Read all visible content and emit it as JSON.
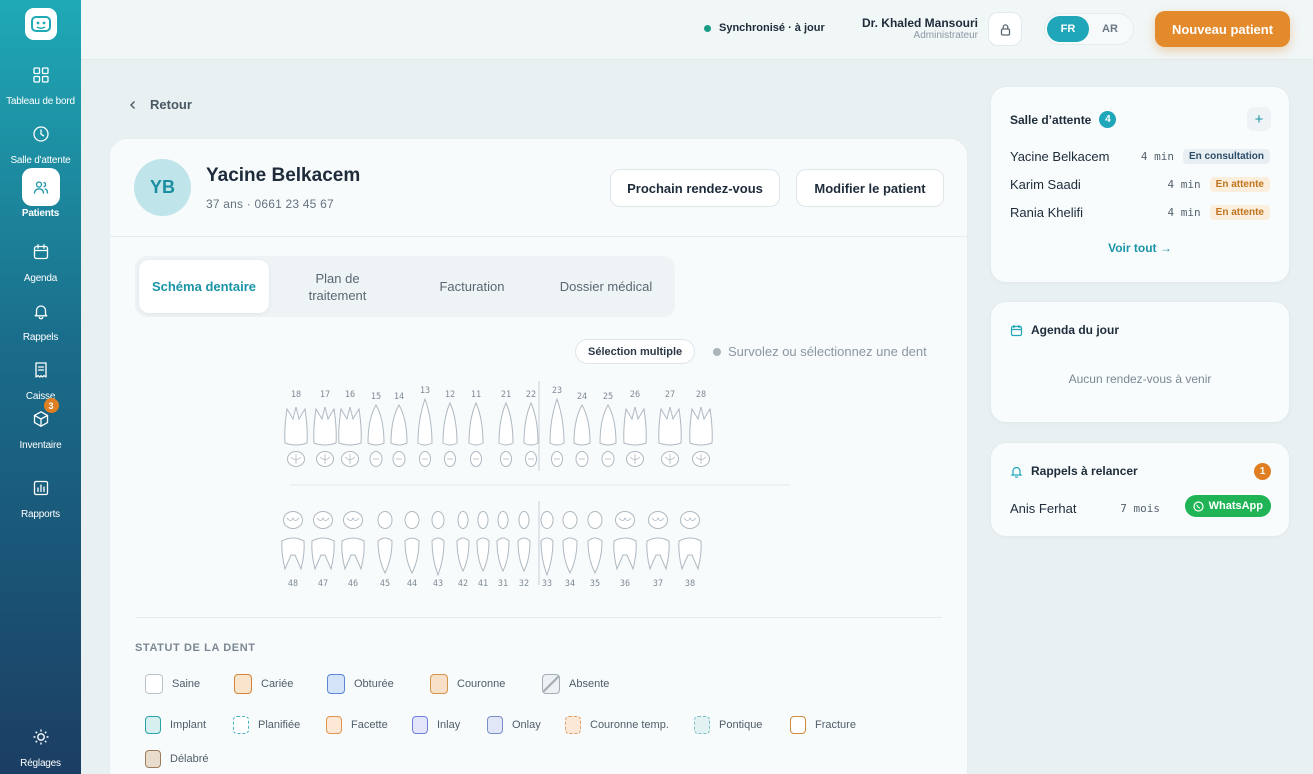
{
  "sidebar": {
    "items": [
      {
        "label": "Tableau de bord",
        "icon": "dashboard-grid-icon"
      },
      {
        "label": "Salle d'attente",
        "icon": "clock-icon"
      },
      {
        "label": "Patients",
        "icon": "users-icon",
        "active": true
      },
      {
        "label": "Agenda",
        "icon": "calendar-icon"
      },
      {
        "label": "Rappels",
        "icon": "bell-icon"
      },
      {
        "label": "Caisse",
        "icon": "receipt-icon"
      },
      {
        "label": "Inventaire",
        "icon": "box-icon",
        "badge": "3"
      },
      {
        "label": "Rapports",
        "icon": "bar-chart-icon"
      }
    ],
    "settings_label": "Réglages"
  },
  "topbar": {
    "sync_status": "Synchronisé · à jour",
    "user_name": "Dr. Khaled Mansouri",
    "user_role": "Administrateur",
    "lang_fr": "FR",
    "lang_ar": "AR",
    "new_patient_label": "Nouveau patient"
  },
  "back_label": "Retour",
  "patient": {
    "initials": "YB",
    "name": "Yacine Belkacem",
    "meta": "37 ans · 0661 23 45 67",
    "next_appointment_label": "Prochain rendez-vous",
    "edit_label": "Modifier le patient"
  },
  "tabs": [
    {
      "label": "Schéma dentaire",
      "active": true
    },
    {
      "label": "Plan de traitement"
    },
    {
      "label": "Facturation"
    },
    {
      "label": "Dossier médical"
    }
  ],
  "dental_chart": {
    "multi_select_label": "Sélection multiple",
    "hint": "Survolez ou sélectionnez une dent",
    "upper_numbers": [
      "18",
      "17",
      "16",
      "15",
      "14",
      "13",
      "12",
      "11",
      "21",
      "22",
      "23",
      "24",
      "25",
      "26",
      "27",
      "28"
    ],
    "lower_numbers": [
      "48",
      "47",
      "46",
      "45",
      "44",
      "43",
      "42",
      "41",
      "31",
      "32",
      "33",
      "34",
      "35",
      "36",
      "37",
      "38"
    ]
  },
  "tooth_status": {
    "title": "STATUT DE LA DENT",
    "primary": [
      {
        "label": "Saine",
        "color": "#b7c2ca",
        "fill": "#ffffff"
      },
      {
        "label": "Cariée",
        "color": "#d4843a",
        "fill": "#fbe4cc"
      },
      {
        "label": "Obturée",
        "color": "#5b87d6",
        "fill": "#d6e4fa"
      },
      {
        "label": "Couronne",
        "color": "#d4924a",
        "fill": "#f8e0c8"
      },
      {
        "label": "Absente",
        "color": "#a3aeb7",
        "fill": "#eef1f3"
      }
    ],
    "secondary": [
      {
        "label": "Implant",
        "color": "#2aa3a8",
        "fill": "#d6f0f0"
      },
      {
        "label": "Planifiée",
        "color": "#4ab3c4",
        "fill": "#ffffff",
        "dashed": true
      },
      {
        "label": "Facette",
        "color": "#e0954c",
        "fill": "#fce8d4"
      },
      {
        "label": "Inlay",
        "color": "#6f7fd8",
        "fill": "#e3e6fb"
      },
      {
        "label": "Onlay",
        "color": "#7a8ec8",
        "fill": "#e1e7f6"
      },
      {
        "label": "Couronne temp.",
        "color": "#e0a06a",
        "fill": "#fbe8d6",
        "dashed": true
      },
      {
        "label": "Pontique",
        "color": "#7fc1c4",
        "fill": "#e2f2f3",
        "dashed": true
      },
      {
        "label": "Fracture",
        "color": "#d08a3c",
        "fill": "#ffffff"
      },
      {
        "label": "Délabré",
        "color": "#9c7c5a",
        "fill": "#e8dccd"
      }
    ]
  },
  "waiting_room": {
    "title": "Salle d’attente",
    "count": "4",
    "rows": [
      {
        "name": "Yacine Belkacem",
        "time": "4 min",
        "status": "En consultation",
        "kind": "consult"
      },
      {
        "name": "Karim Saadi",
        "time": "4 min",
        "status": "En attente",
        "kind": "wait"
      },
      {
        "name": "Rania Khelifi",
        "time": "4 min",
        "status": "En attente",
        "kind": "wait"
      }
    ],
    "see_all": "Voir tout →"
  },
  "agenda": {
    "title": "Agenda du jour",
    "empty": "Aucun rendez-vous à venir"
  },
  "reminders": {
    "title": "Rappels à relancer",
    "count": "1",
    "row": {
      "name": "Anis Ferhat",
      "time": "7 mois",
      "action": "WhatsApp"
    }
  }
}
